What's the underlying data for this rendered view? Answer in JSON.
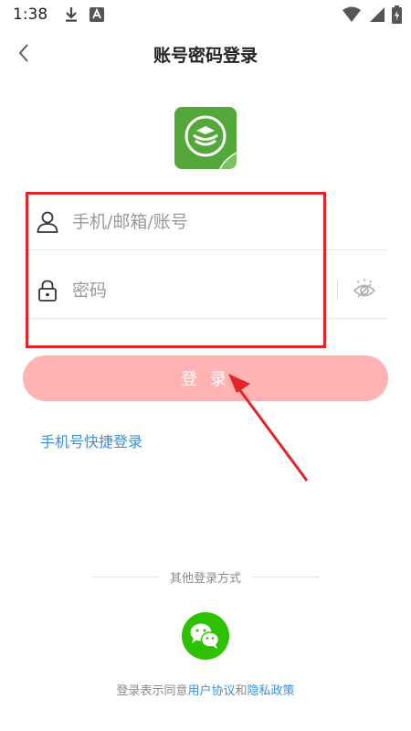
{
  "status_bar": {
    "time": "1:38",
    "icons": [
      "download-icon",
      "app-notification-icon",
      "wifi-icon",
      "signal-icon",
      "battery-charging-icon"
    ]
  },
  "nav": {
    "title": "账号密码登录",
    "back_icon": "chevron-left-icon"
  },
  "logo": {
    "icon": "app-logo-icon",
    "color": "#54a83a"
  },
  "form": {
    "account_placeholder": "手机/邮箱/账号",
    "account_value": "",
    "password_placeholder": "密码",
    "password_value": "",
    "user_icon": "user-icon",
    "lock_icon": "lock-icon",
    "eye_icon": "eye-hidden-icon"
  },
  "login_button": {
    "label": "登 录",
    "color": "#ffb3b3"
  },
  "quick_login": {
    "label": "手机号快捷登录",
    "color": "#3c8fd9"
  },
  "other_login": {
    "label": "其他登录方式",
    "wechat_icon": "wechat-icon",
    "wechat_color": "#2dc100"
  },
  "agreement": {
    "prefix": "登录表示同意",
    "user_agreement": "用户协议",
    "conjunction": "和",
    "privacy_policy": "隐私政策"
  },
  "annotation": {
    "highlight_color": "#e0242a"
  }
}
